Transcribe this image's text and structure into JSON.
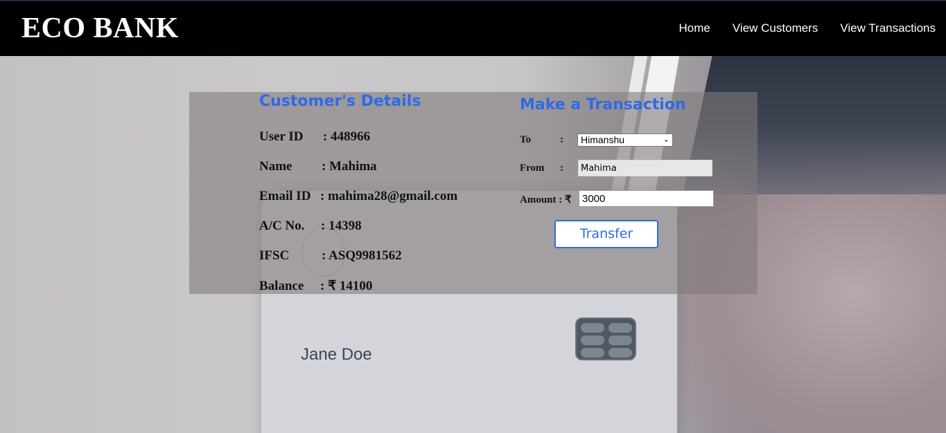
{
  "header": {
    "brand": "ECO BANK",
    "nav": [
      "Home",
      "View Customers",
      "View Transactions"
    ]
  },
  "background": {
    "cardholder": "Jane Doe"
  },
  "customer": {
    "title": "Customer's Details",
    "rows": [
      {
        "label": "User ID",
        "value": ": 448966"
      },
      {
        "label": "Name",
        "value": ": Mahima"
      },
      {
        "label": "Email ID",
        "value": ": mahima28@gmail.com"
      },
      {
        "label": "A/C No.",
        "value": ": 14398"
      },
      {
        "label": "IFSC",
        "value": ": ASQ9981562"
      },
      {
        "label": "Balance",
        "value": ": ₹ 14100"
      }
    ]
  },
  "transaction": {
    "title": "Make a Transaction",
    "to_label": "To",
    "to_value": "Himanshu",
    "from_label": "From",
    "from_value": "Mahima",
    "amount_label": "Amount : ₹",
    "amount_value": "3000",
    "colon": ":",
    "button": "Transfer"
  },
  "colors": {
    "accent": "#2f6ae6",
    "header_bg": "#000000"
  }
}
